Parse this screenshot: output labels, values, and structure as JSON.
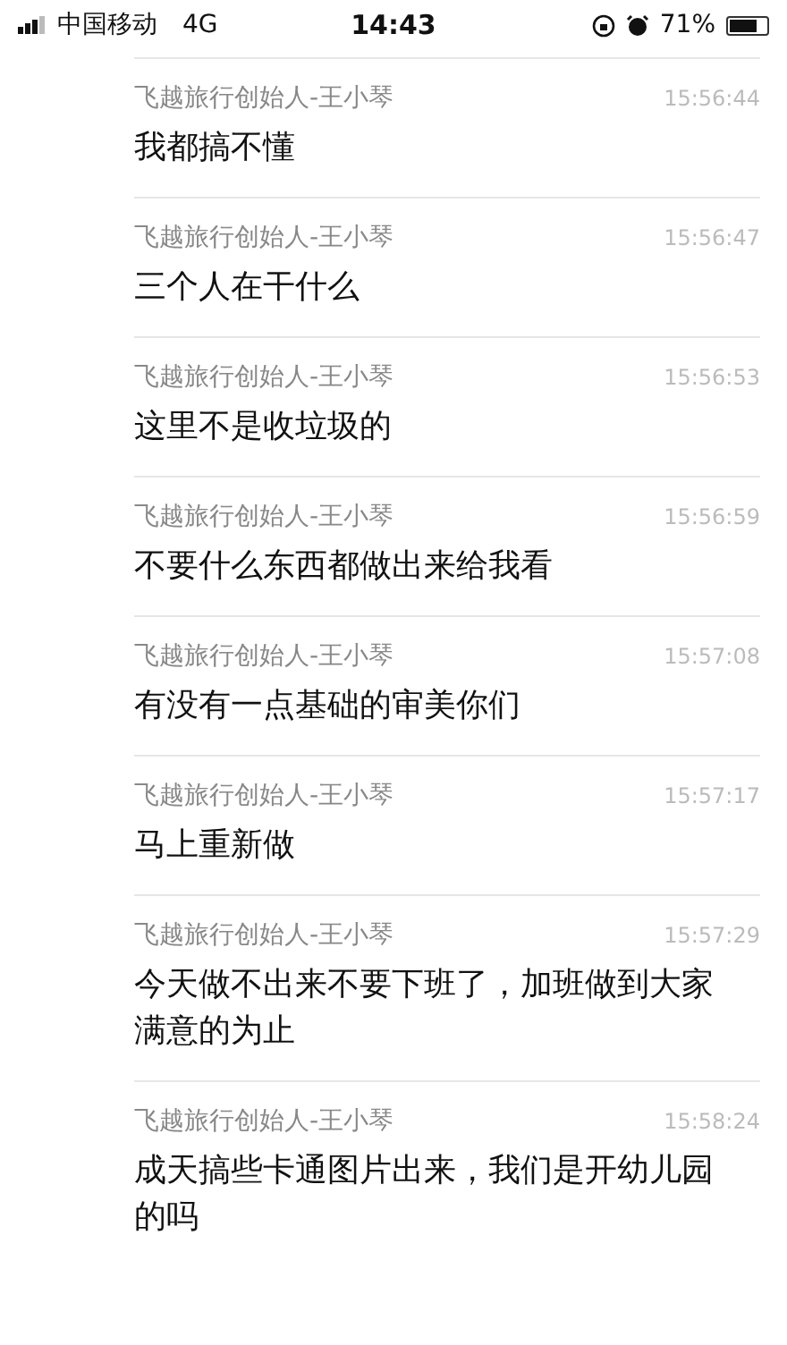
{
  "status_bar": {
    "carrier": "中国移动",
    "network": "4G",
    "time": "14:43",
    "battery_percent": "71%"
  },
  "messages": [
    {
      "sender": "飞越旅行创始人-王小琴",
      "time": "15:56:44",
      "text": "我都搞不懂"
    },
    {
      "sender": "飞越旅行创始人-王小琴",
      "time": "15:56:47",
      "text": "三个人在干什么"
    },
    {
      "sender": "飞越旅行创始人-王小琴",
      "time": "15:56:53",
      "text": "这里不是收垃圾的"
    },
    {
      "sender": "飞越旅行创始人-王小琴",
      "time": "15:56:59",
      "text": "不要什么东西都做出来给我看"
    },
    {
      "sender": "飞越旅行创始人-王小琴",
      "time": "15:57:08",
      "text": "有没有一点基础的审美你们"
    },
    {
      "sender": "飞越旅行创始人-王小琴",
      "time": "15:57:17",
      "text": "马上重新做"
    },
    {
      "sender": "飞越旅行创始人-王小琴",
      "time": "15:57:29",
      "text": "今天做不出来不要下班了，加班做到大家满意的为止"
    },
    {
      "sender": "飞越旅行创始人-王小琴",
      "time": "15:58:24",
      "text": "成天搞些卡通图片出来，我们是开幼儿园的吗"
    }
  ]
}
